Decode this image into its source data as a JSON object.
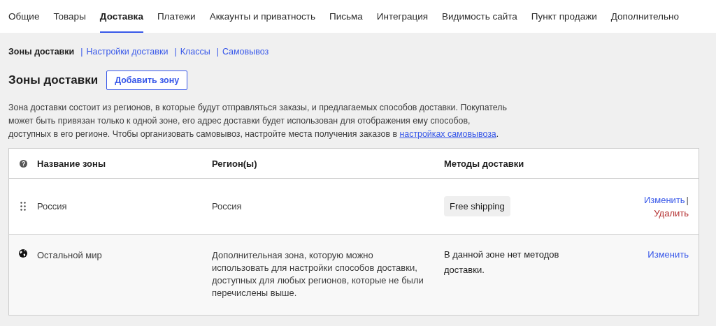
{
  "tabs": [
    {
      "label": "Общие",
      "selected": false
    },
    {
      "label": "Товары",
      "selected": false
    },
    {
      "label": "Доставка",
      "selected": true
    },
    {
      "label": "Платежи",
      "selected": false
    },
    {
      "label": "Аккаунты и приватность",
      "selected": false
    },
    {
      "label": "Письма",
      "selected": false
    },
    {
      "label": "Интеграция",
      "selected": false
    },
    {
      "label": "Видимость сайта",
      "selected": false
    },
    {
      "label": "Пункт продажи",
      "selected": false
    },
    {
      "label": "Дополнительно",
      "selected": false
    }
  ],
  "subnav": [
    {
      "label": "Зоны доставки",
      "selected": true
    },
    {
      "prefix": "|",
      "label": "Настройки доставки",
      "selected": false
    },
    {
      "prefix": "|",
      "label": "Классы",
      "selected": false
    },
    {
      "prefix": "|",
      "label": "Самовывоз",
      "selected": false
    }
  ],
  "heading": "Зоны доставки",
  "add_button": "Добавить зону",
  "description": {
    "text": "Зона доставки состоит из регионов, в которые будут отправляться заказы, и предлагаемых способов доставки. Покупатель может быть привязан только к одной зоне, его адрес доставки будет использован для отображения ему способов, доступных в его регионе. Чтобы организовать самовывоз, настройте места получения заказов в ",
    "link": "настройках самовывоза",
    "end": "."
  },
  "table": {
    "columns": [
      "Название зоны",
      "Регион(ы)",
      "Методы доставки"
    ],
    "rows": [
      {
        "kind": "zone",
        "name": "Россия",
        "regions": "Россия",
        "methods": [
          "Free shipping"
        ],
        "actions": [
          {
            "kind": "edit",
            "label": "Изменить",
            "suffix": "|"
          },
          {
            "kind": "delete",
            "label": "Удалить"
          }
        ]
      },
      {
        "kind": "rest",
        "name": "Остальной мир",
        "regions": "Дополнительная зона, которую можно использовать для настройки способов доставки, доступных для любых регионов, которые не были перечислены выше.",
        "note": "В данной зоне нет методов доставки.",
        "actions": [
          {
            "kind": "edit",
            "label": "Изменить"
          }
        ]
      }
    ]
  }
}
